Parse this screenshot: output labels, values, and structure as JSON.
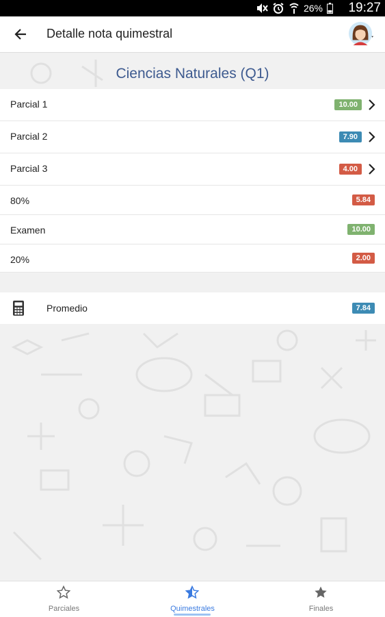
{
  "status_bar": {
    "battery": "26%",
    "time": "19:27"
  },
  "app_bar": {
    "title": "Detalle nota quimestral"
  },
  "subject": {
    "title": "Ciencias Naturales (Q1)"
  },
  "grades": [
    {
      "label": "Parcial 1",
      "value": "10.00",
      "color": "#7fb26f"
    },
    {
      "label": "Parcial 2",
      "value": "7.90",
      "color": "#3d8bb4"
    },
    {
      "label": "Parcial 3",
      "value": "4.00",
      "color": "#d35b45"
    },
    {
      "label": "80%",
      "value": "5.84",
      "color": "#d35b45"
    },
    {
      "label": "Examen",
      "value": "10.00",
      "color": "#7fb26f"
    },
    {
      "label": "20%",
      "value": "2.00",
      "color": "#d35b45"
    }
  ],
  "average": {
    "label": "Promedio",
    "value": "7.84",
    "color": "#3d8bb4"
  },
  "bottom_nav": [
    {
      "label": "Parciales",
      "icon": "star-outline-icon"
    },
    {
      "label": "Quimestrales",
      "icon": "star-half-icon",
      "active": true
    },
    {
      "label": "Finales",
      "icon": "star-filled-icon"
    }
  ]
}
